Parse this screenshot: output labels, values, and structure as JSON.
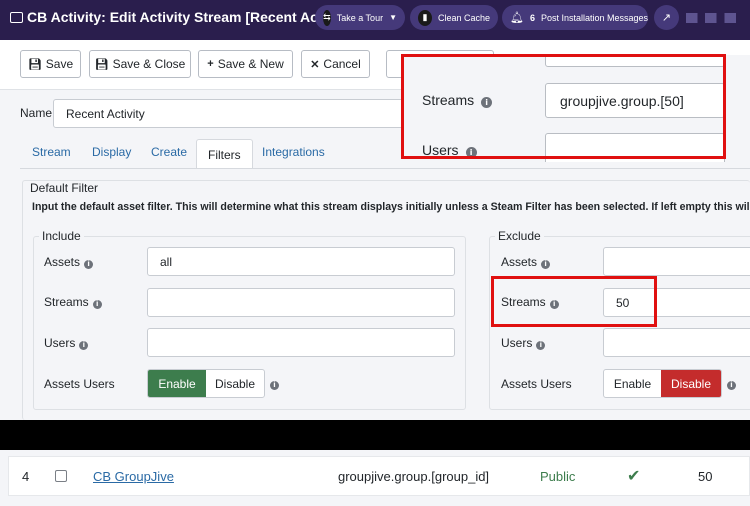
{
  "header": {
    "title": "CB Activity: Edit Activity Stream [Recent Activity]",
    "pills": [
      {
        "label": "Take a Tour",
        "icon": "signpost-icon"
      },
      {
        "label": "Clean Cache",
        "icon": "trash-icon"
      },
      {
        "label": "Post Installation Messages",
        "icon": "bell-icon",
        "count": "6"
      }
    ]
  },
  "toolbar": {
    "save": "Save",
    "save_close": "Save & Close",
    "save_new": "Save & New",
    "cancel": "Cancel"
  },
  "name_field": {
    "label": "Name",
    "value": "Recent Activity"
  },
  "tabs": [
    "Stream",
    "Display",
    "Create",
    "Filters",
    "Integrations"
  ],
  "active_tab": "Filters",
  "default_filter": {
    "legend": "Default Filter",
    "description": "Input the default asset filter. This will determine what this stream displays initially unless a Steam Filter has been selected. If left empty this wil"
  },
  "include": {
    "legend": "Include",
    "assets_label": "Assets",
    "assets_value": "all",
    "streams_label": "Streams",
    "streams_value": "",
    "users_label": "Users",
    "users_value": "",
    "assets_users_label": "Assets Users",
    "enable": "Enable",
    "disable": "Disable"
  },
  "exclude": {
    "legend": "Exclude",
    "assets_label": "Assets",
    "streams_label": "Streams",
    "streams_value": "50",
    "users_label": "Users",
    "assets_users_label": "Assets Users",
    "enable": "Enable",
    "disable": "Disable"
  },
  "zoom_inset": {
    "streams_label": "Streams",
    "streams_value": "groupjive.group.[50]",
    "users_label": "Users"
  },
  "table_row": {
    "num": "4",
    "name": "CB GroupJive",
    "asset": "groupjive.group.[group_id]",
    "access": "Public",
    "id": "50"
  },
  "colors": {
    "header_bg": "#2a1e4d",
    "enable_green": "#3d7d4d",
    "disable_red": "#c42c2c",
    "highlight_red": "#e01010",
    "public_green": "#3d7d4d"
  }
}
